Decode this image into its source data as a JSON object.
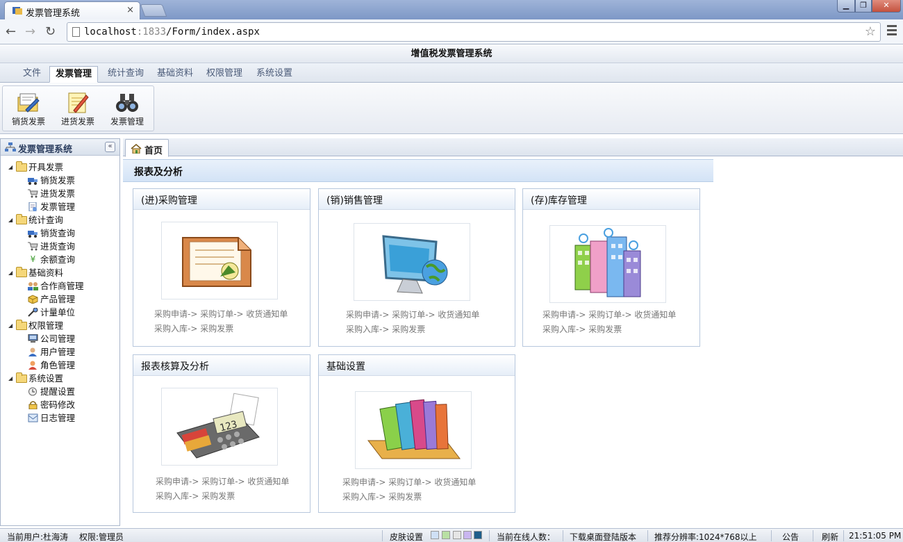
{
  "browser": {
    "tab_title": "发票管理系统",
    "tab_close": "×",
    "url_host": "localhost",
    "url_port": ":1833",
    "url_path": "/Form/index.aspx"
  },
  "app": {
    "title": "增值税发票管理系统",
    "menu_tabs": [
      "文件",
      "发票管理",
      "统计查询",
      "基础资料",
      "权限管理",
      "系统设置"
    ],
    "active_menu": "发票管理",
    "ribbon": [
      {
        "label": "销货发票",
        "icon": "sales-invoice-icon"
      },
      {
        "label": "进货发票",
        "icon": "purchase-invoice-icon"
      },
      {
        "label": "发票管理",
        "icon": "binoculars-icon"
      }
    ]
  },
  "sidebar": {
    "title": "发票管理系统",
    "collapse": "«",
    "groups": [
      {
        "label": "开具发票",
        "items": [
          {
            "label": "销货发票",
            "icon": "truck-icon"
          },
          {
            "label": "进货发票",
            "icon": "cart-icon"
          },
          {
            "label": "发票管理",
            "icon": "document-icon"
          }
        ]
      },
      {
        "label": "统计查询",
        "items": [
          {
            "label": "销货查询",
            "icon": "truck-icon"
          },
          {
            "label": "进货查询",
            "icon": "cart-icon"
          },
          {
            "label": "余额查询",
            "icon": "yen-icon"
          }
        ]
      },
      {
        "label": "基础资料",
        "items": [
          {
            "label": "合作商管理",
            "icon": "partners-icon"
          },
          {
            "label": "产品管理",
            "icon": "product-box-icon"
          },
          {
            "label": "计量单位",
            "icon": "tool-icon"
          }
        ]
      },
      {
        "label": "权限管理",
        "items": [
          {
            "label": "公司管理",
            "icon": "computer-icon"
          },
          {
            "label": "用户管理",
            "icon": "user-icon"
          },
          {
            "label": "角色管理",
            "icon": "role-icon"
          }
        ]
      },
      {
        "label": "系统设置",
        "items": [
          {
            "label": "提醒设置",
            "icon": "clock-icon"
          },
          {
            "label": "密码修改",
            "icon": "lock-icon"
          },
          {
            "label": "日志管理",
            "icon": "log-icon"
          }
        ]
      }
    ]
  },
  "main": {
    "home_tab": "首页",
    "section_title": "报表及分析",
    "panels": [
      {
        "title": "(进)采购管理",
        "line1": "采购申请-> 采购订单-> 收货通知单",
        "line2": "采购入库-> 采购发票",
        "icon": "folder-document-icon"
      },
      {
        "title": "(销)销售管理",
        "line1": "采购申请-> 采购订单-> 收货通知单",
        "line2": "采购入库-> 采购发票",
        "icon": "monitor-globe-icon"
      },
      {
        "title": "(存)库存管理",
        "line1": "采购申请-> 采购订单-> 收货通知单",
        "line2": "采购入库-> 采购发票",
        "icon": "buildings-icon"
      },
      {
        "title": "报表核算及分析",
        "line1": "采购申请-> 采购订单-> 收货通知单",
        "line2": "采购入库-> 采购发票",
        "icon": "calculator-icon"
      },
      {
        "title": "基础设置",
        "line1": "采购申请-> 采购订单-> 收货通知单",
        "line2": "采购入库-> 采购发票",
        "icon": "books-icon"
      }
    ]
  },
  "status": {
    "user": "当前用户:杜海涛",
    "role": "权限:管理员",
    "skin_label": "皮肤设置",
    "skin_colors": [
      "#cfe0f5",
      "#b9e0a4",
      "#e6e6e6",
      "#c9b6f0",
      "#1f5f8b"
    ],
    "online": "当前在线人数：",
    "download": "下载桌面登陆版本",
    "resolution": "推荐分辨率:1024*768以上",
    "notice": "公告",
    "refresh": "刷新",
    "time": "21:51:05 PM"
  }
}
